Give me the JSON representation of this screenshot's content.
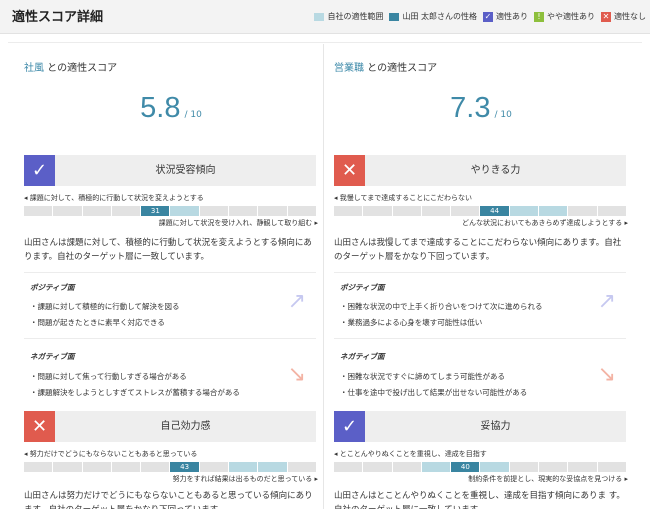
{
  "page_title": "適性スコア詳細",
  "legend": {
    "range_label": "自社の適性範囲",
    "person_label": "山田 太郎さんの性格",
    "fit_label": "適性あり",
    "partial_label": "やや適性あり",
    "nofit_label": "適性なし",
    "partial_icon": "!",
    "colors": {
      "range": "#b8d9e2",
      "person": "#3a85a1",
      "fit": "#5b5fc7",
      "partial": "#8dbf3c",
      "nofit": "#e05b4e"
    }
  },
  "left": {
    "title_link": "社風",
    "title_suffix": " との適性スコア",
    "score": "5.8",
    "denominator": "/ 10",
    "traits": [
      {
        "status": "fit",
        "name": "状況受容傾向",
        "left_label": "課題に対して、積極的に行動して状況を変えようとする",
        "right_label": "課題に対して状況を受け入れ、静観して取り組む",
        "value": "31",
        "description": "山田さんは課題に対して、積極的に行動して状況を変えようとする傾向にあります。自社のターゲット層に一致しています。",
        "positive_title": "ポジティブ面",
        "positive_points": [
          "・課題に対して積極的に行動して解決を図る",
          "・問題が起きたときに素早く対応できる"
        ],
        "negative_title": "ネガティブ面",
        "negative_points": [
          "・問題に対して焦って行動しすぎる場合がある",
          "・課題解決をしようとしすぎてストレスが蓄積する場合がある"
        ]
      },
      {
        "status": "nofit",
        "name": "自己効力感",
        "left_label": "努力だけでどうにもならないこともあると思っている",
        "right_label": "努力をすれば結果は出るものだと思っている",
        "value": "43",
        "description": "山田さんは努力だけでどうにもならないこともあると思っている傾向にあります。自社のターゲット層をかなり下回っています。"
      }
    ]
  },
  "right": {
    "title_link": "営業職",
    "title_suffix": " との適性スコア",
    "score": "7.3",
    "denominator": "/ 10",
    "traits": [
      {
        "status": "nofit",
        "name": "やりきる力",
        "left_label": "我慢してまで達成することにこだわらない",
        "right_label": "どんな状況においてもあきらめず達成しようとする",
        "value": "44",
        "description": "山田さんは我慢してまで達成することにこだわらない傾向にあります。自社のターゲット層をかなり下回っています。",
        "positive_title": "ポジティブ面",
        "positive_points": [
          "・困難な状況の中で上手く折り合いをつけて次に進められる",
          "・業務過多による心身を壊す可能性は低い"
        ],
        "negative_title": "ネガティブ面",
        "negative_points": [
          "・困難な状況ですぐに諦めてしまう可能性がある",
          "・仕事を途中で投げ出して結果が出せない可能性がある"
        ]
      },
      {
        "status": "fit",
        "name": "妥協力",
        "left_label": "とことんやりぬくことを重視し、達成を目指す",
        "right_label": "制約条件を前提とし、現実的な妥協点を見つける",
        "value": "40",
        "description": "山田さんはとことんやりぬくことを重視し、達成を目指す傾向にありま す。自社のターゲット層に一致しています。"
      }
    ]
  }
}
